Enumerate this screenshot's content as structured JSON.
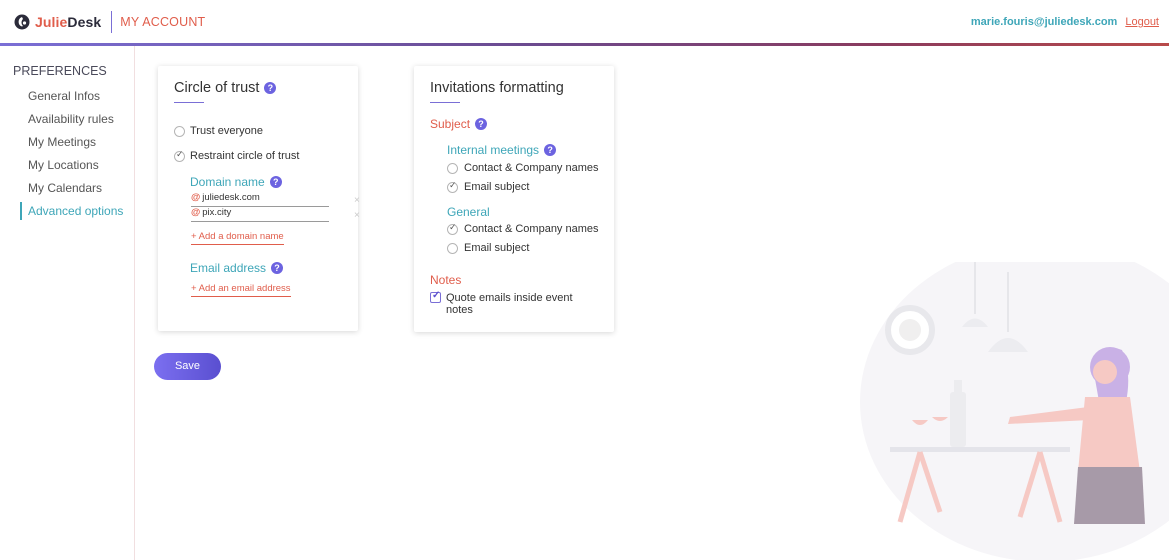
{
  "header": {
    "brand_first": "Julie",
    "brand_second": "Desk",
    "section": "MY ACCOUNT",
    "user_email": "marie.fouris@juliedesk.com",
    "logout": "Logout"
  },
  "sidebar": {
    "heading": "PREFERENCES",
    "items": [
      {
        "label": "General Infos"
      },
      {
        "label": "Availability rules"
      },
      {
        "label": "My Meetings"
      },
      {
        "label": "My Locations"
      },
      {
        "label": "My Calendars"
      },
      {
        "label": "Advanced options",
        "active": true
      }
    ]
  },
  "circle_of_trust": {
    "title": "Circle of trust",
    "help": "?",
    "options": [
      {
        "label": "Trust everyone",
        "checked": false
      },
      {
        "label": "Restraint circle of trust",
        "checked": true
      }
    ],
    "domain_label": "Domain name",
    "at_symbol": "@",
    "domains": [
      "juliedesk.com",
      "pix.city"
    ],
    "remove_symbol": "×",
    "add_domain": "+ Add a domain name",
    "email_label": "Email address",
    "add_email": "+ Add an email address"
  },
  "invitations": {
    "title": "Invitations formatting",
    "subject_label": "Subject",
    "internal_label": "Internal meetings",
    "internal_options": [
      {
        "label": "Contact & Company names",
        "checked": false
      },
      {
        "label": "Email subject",
        "checked": true
      }
    ],
    "general_label": "General",
    "general_options": [
      {
        "label": "Contact & Company names",
        "checked": true
      },
      {
        "label": "Email subject",
        "checked": false
      }
    ],
    "notes_label": "Notes",
    "notes_option": {
      "label_line1": "Quote emails inside event",
      "label_line2": "notes",
      "checked": true
    }
  },
  "save_button": "Save",
  "colors": {
    "accent_purple": "#6c63e0",
    "accent_red": "#e05d4b",
    "accent_teal": "#3ea6b8"
  }
}
